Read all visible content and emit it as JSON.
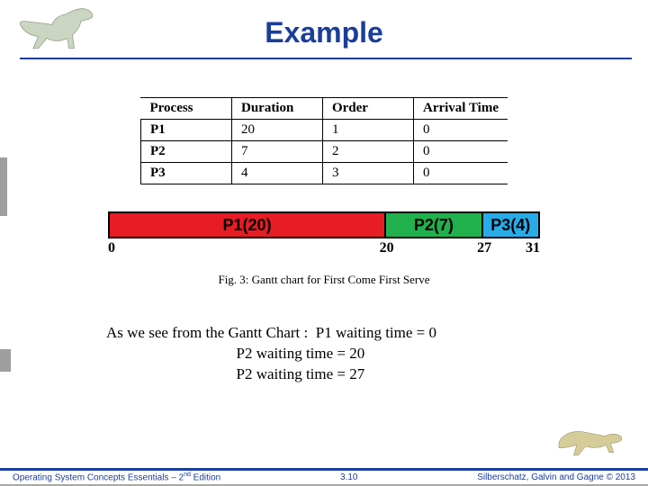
{
  "title": "Example",
  "table": {
    "headers": [
      "Process",
      "Duration",
      "Order",
      "Arrival Time"
    ],
    "rows": [
      {
        "p": "P1",
        "d": "20",
        "o": "1",
        "a": "0"
      },
      {
        "p": "P2",
        "d": "7",
        "o": "2",
        "a": "0"
      },
      {
        "p": "P3",
        "d": "4",
        "o": "3",
        "a": "0"
      }
    ]
  },
  "gantt": {
    "total": 31,
    "segments": [
      {
        "label": "P1(20)",
        "start": 0,
        "end": 20,
        "color": "red"
      },
      {
        "label": "P2(7)",
        "start": 20,
        "end": 27,
        "color": "green"
      },
      {
        "label": "P3(4)",
        "start": 27,
        "end": 31,
        "color": "blue"
      }
    ],
    "ticks": [
      "0",
      "20",
      "27",
      "31"
    ]
  },
  "caption": "Fig. 3: Gantt chart for First Come First Serve",
  "waiting": {
    "lead": "As we see from the Gantt Chart :  P1 waiting time = 0",
    "l2": "P2 waiting time = 20",
    "l3": "P2 waiting time = 27"
  },
  "footer": {
    "left_a": "Operating System Concepts Essentials – 2",
    "left_sup": "nd",
    "left_b": " Edition",
    "center": "3.10",
    "right": "Silberschatz, Galvin and Gagne © 2013"
  }
}
